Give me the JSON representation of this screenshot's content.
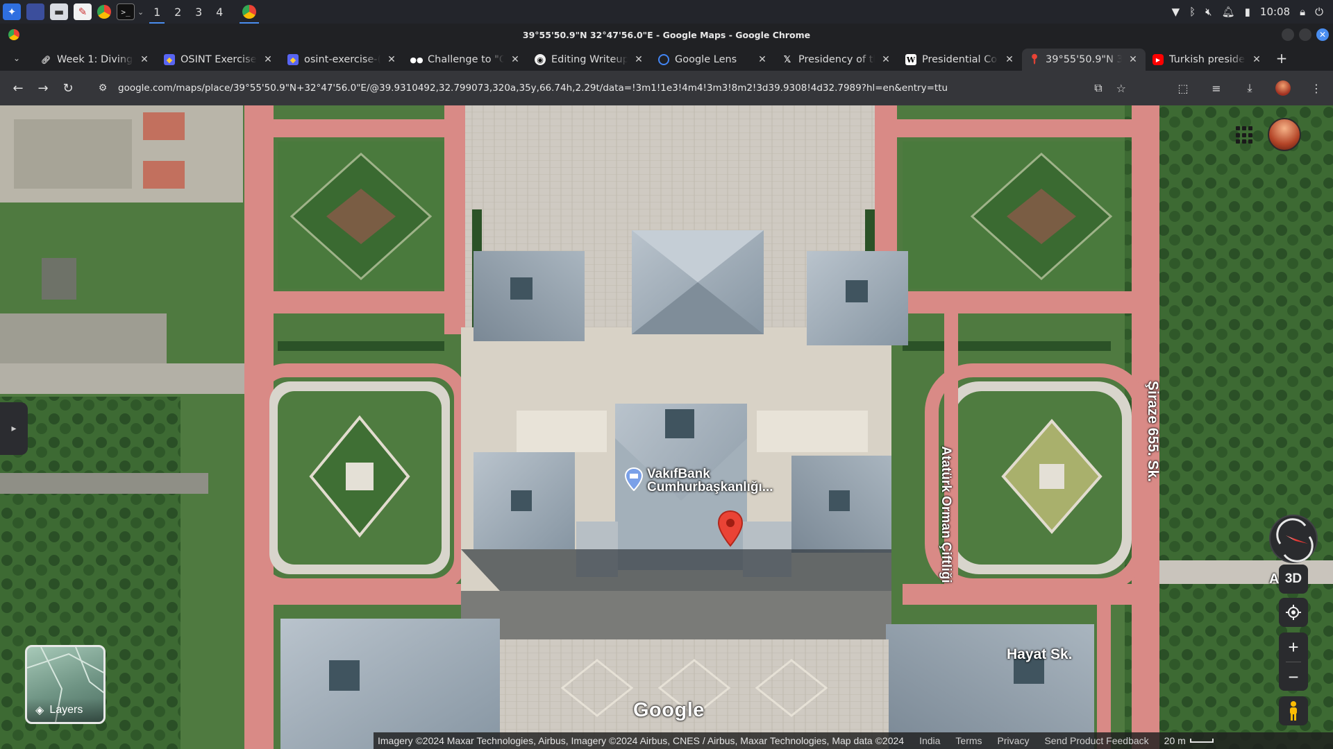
{
  "os": {
    "workspaces": [
      "1",
      "2",
      "3",
      "4"
    ],
    "active_workspace": "1",
    "clock": "10:08",
    "launcher_icon": "launcher-icon",
    "pinned_icons": [
      "desktop-icon",
      "files-icon",
      "document-viewer-icon",
      "chrome-icon",
      "terminal-icon"
    ],
    "tray_icons": [
      "wifi-icon",
      "bluetooth-icon",
      "mute-icon",
      "bell-icon",
      "battery-icon",
      "lock-icon",
      "power-icon"
    ]
  },
  "window": {
    "title": "39°55'50.9\"N 32°47'56.0\"E - Google Maps - Google Chrome"
  },
  "tabs": [
    {
      "label": "Week 1: Diving i",
      "icon": "link-icon",
      "active": false
    },
    {
      "label": "OSINT Exercise",
      "icon": "osint-icon",
      "active": false
    },
    {
      "label": "osint-exercise-(",
      "icon": "osint-icon",
      "active": false
    },
    {
      "label": "Challenge to \"O",
      "icon": "medium-icon",
      "active": false
    },
    {
      "label": "Editing Writeup",
      "icon": "github-icon",
      "active": false
    },
    {
      "label": "Google Lens",
      "icon": "google-lens-icon",
      "active": false
    },
    {
      "label": "Presidency of th",
      "icon": "x-icon",
      "active": false
    },
    {
      "label": "Presidential Cor",
      "icon": "wikipedia-icon",
      "active": false
    },
    {
      "label": "39°55'50.9\"N 3",
      "icon": "maps-pin-icon",
      "active": true
    },
    {
      "label": "Turkish presider",
      "icon": "youtube-icon",
      "active": false
    }
  ],
  "toolbar": {
    "url": "google.com/maps/place/39°55'50.9\"N+32°47'56.0\"E/@39.9310492,32.799073,320a,35y,66.74h,2.29t/data=!3m1!1e3!4m4!3m3!8m2!3d39.9308!4d32.7989?hl=en&entry=ttu"
  },
  "map": {
    "poi_name_line1": "VakıfBank",
    "poi_name_line2": "Cumhurbaşkanlığı...",
    "roads": {
      "ataturk": "Atatürk Orman Çiftliği",
      "siraze": "Şiraze 655. Sk.",
      "hayat": "Hayat Sk.",
      "partial": "A"
    },
    "layers_label": "Layers",
    "btn_3d": "3D",
    "google_logo": "Google",
    "footer": {
      "imagery": "Imagery ©2024 Maxar Technologies, Airbus, Imagery ©2024 Airbus, CNES / Airbus, Maxar Technologies, Map data ©2024",
      "country": "India",
      "terms": "Terms",
      "privacy": "Privacy",
      "feedback": "Send Product Feedback",
      "scale": "20 m"
    },
    "colors": {
      "path_pink": "#d98a86",
      "grass": "#3f6b34",
      "roof": "#9aa8b4",
      "plaza": "#c9c4bc"
    }
  }
}
